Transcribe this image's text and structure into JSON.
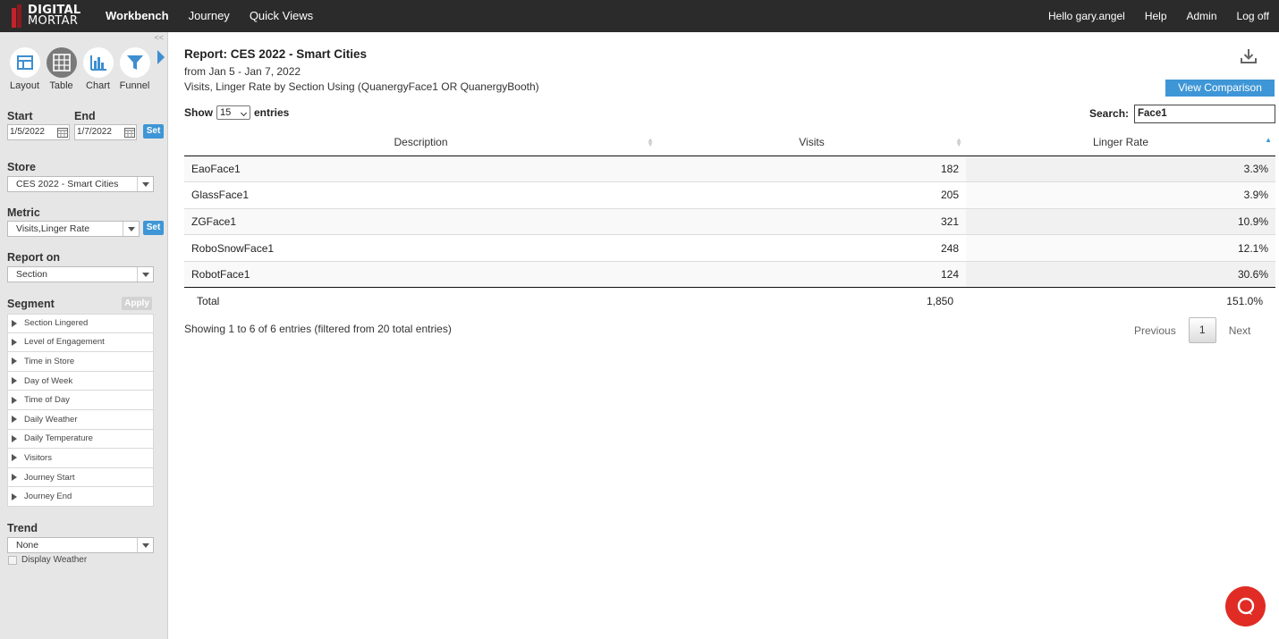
{
  "app": {
    "logo_line1": "DIGITAL",
    "logo_line2": "MORTAR",
    "brand_color": "#c4232b",
    "accent_color": "#3e96d6"
  },
  "topnav": {
    "items": [
      {
        "label": "Workbench",
        "active": true
      },
      {
        "label": "Journey",
        "active": false
      },
      {
        "label": "Quick Views",
        "active": false
      }
    ],
    "right": [
      "Hello gary.angel",
      "Help",
      "Admin",
      "Log off"
    ]
  },
  "sidebar": {
    "collapse_label": "<<",
    "views": [
      {
        "label": "Layout",
        "icon": "layout-icon",
        "active": false
      },
      {
        "label": "Table",
        "icon": "table-icon",
        "active": true
      },
      {
        "label": "Chart",
        "icon": "chart-icon",
        "active": false
      },
      {
        "label": "Funnel",
        "icon": "funnel-icon",
        "active": false
      }
    ],
    "start_label": "Start",
    "end_label": "End",
    "start_value": "1/5/2022",
    "end_value": "1/7/2022",
    "set_label": "Set",
    "store_label": "Store",
    "store_value": "CES 2022 - Smart Cities",
    "metric_label": "Metric",
    "metric_value": "Visits,Linger Rate",
    "report_on_label": "Report on",
    "report_on_value": "Section",
    "segment_label": "Segment",
    "apply_label": "Apply",
    "segments": [
      "Section Lingered",
      "Level of Engagement",
      "Time in Store",
      "Day of Week",
      "Time of Day",
      "Daily Weather",
      "Daily Temperature",
      "Visitors",
      "Journey Start",
      "Journey End"
    ],
    "trend_label": "Trend",
    "trend_value": "None",
    "display_weather_label": "Display Weather"
  },
  "report": {
    "title": "Report: CES 2022 - Smart Cities",
    "dates": "from Jan 5 - Jan 7, 2022",
    "description": "Visits, Linger Rate by Section Using (QuanergyFace1 OR QuanergyBooth)",
    "view_comparison_label": "View Comparison",
    "show_label": "Show",
    "entries_label": "entries",
    "show_value": "15",
    "search_label": "Search:",
    "search_value": "Face1",
    "columns": [
      "Description",
      "Visits",
      "Linger Rate"
    ],
    "rows": [
      {
        "description": "EaoFace1",
        "visits": "182",
        "linger": "3.3%"
      },
      {
        "description": "GlassFace1",
        "visits": "205",
        "linger": "3.9%"
      },
      {
        "description": "ZGFace1",
        "visits": "321",
        "linger": "10.9%"
      },
      {
        "description": "RoboSnowFace1",
        "visits": "248",
        "linger": "12.1%"
      },
      {
        "description": "RobotFace1",
        "visits": "124",
        "linger": "30.6%"
      }
    ],
    "total": {
      "label": "Total",
      "visits": "1,850",
      "linger": "151.0%"
    },
    "info": "Showing 1 to 6 of 6 entries (filtered from 20 total entries)",
    "pager": {
      "prev": "Previous",
      "page": "1",
      "next": "Next"
    }
  }
}
